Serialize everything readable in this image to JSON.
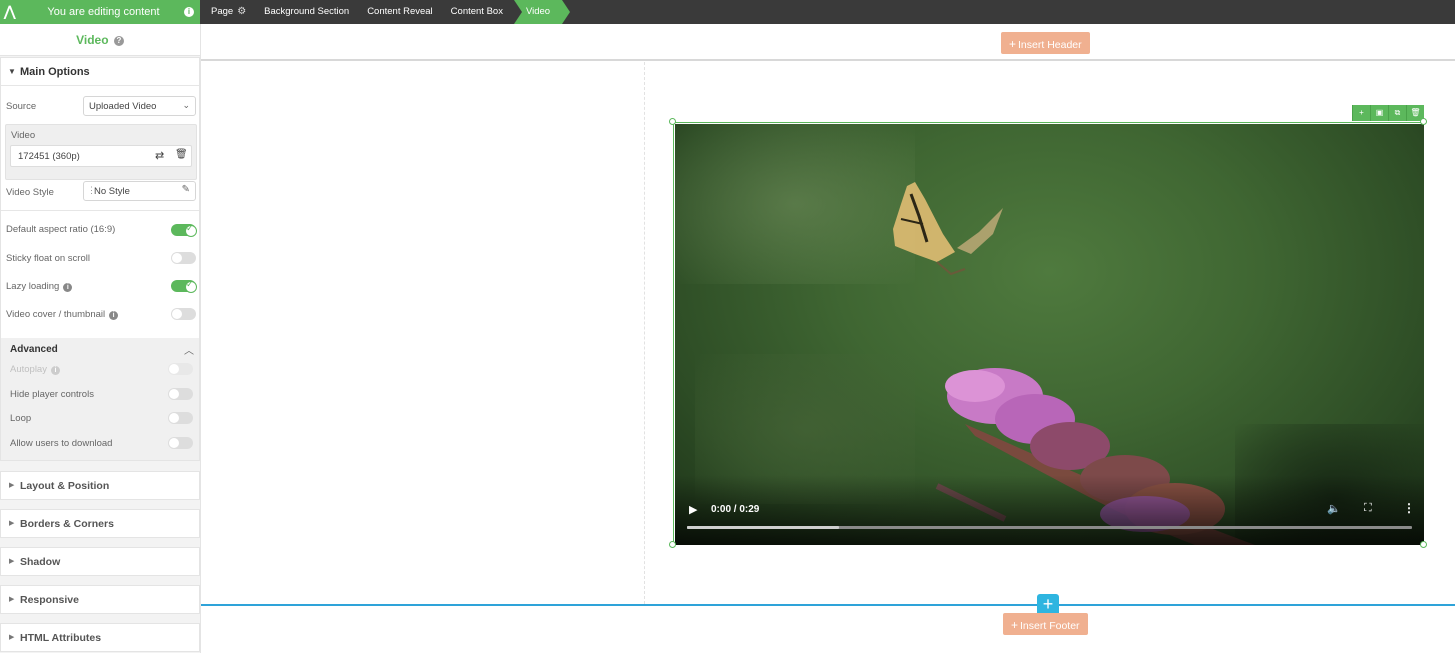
{
  "topbar": {
    "editing_label": "You are editing content",
    "breadcrumbs": [
      "Page",
      "Background Section",
      "Content Reveal",
      "Content Box"
    ],
    "active_crumb": "Video"
  },
  "panel": {
    "title": "Video",
    "main_options": {
      "label": "Main Options",
      "source_label": "Source",
      "source_value": "Uploaded Video",
      "video_label": "Video",
      "video_value": "172451 (360p)",
      "video_style_label": "Video Style",
      "video_style_value": "No Style",
      "toggles": [
        {
          "label": "Default aspect ratio (16:9)",
          "on": true
        },
        {
          "label": "Sticky float on scroll",
          "on": false
        },
        {
          "label": "Lazy loading",
          "on": true
        },
        {
          "label": "Video cover / thumbnail",
          "on": false
        }
      ],
      "advanced": {
        "label": "Advanced",
        "items": [
          {
            "label": "Autoplay",
            "on": false,
            "disabled": true
          },
          {
            "label": "Hide player controls",
            "on": false
          },
          {
            "label": "Loop",
            "on": false
          },
          {
            "label": "Allow users to download",
            "on": false
          }
        ]
      }
    },
    "sections": [
      "Layout & Position",
      "Borders & Corners",
      "Shadow",
      "Responsive",
      "HTML Attributes"
    ]
  },
  "canvas": {
    "insert_header": "Insert Header",
    "insert_footer": "Insert Footer"
  },
  "video": {
    "time": "0:00 / 0:29",
    "progress": 0.21
  },
  "colors": {
    "accent_green": "#5cb85c",
    "insert_orange": "#f0b090",
    "footer_blue": "#2ea3d9",
    "topbar_dark": "#3a3a3a"
  }
}
